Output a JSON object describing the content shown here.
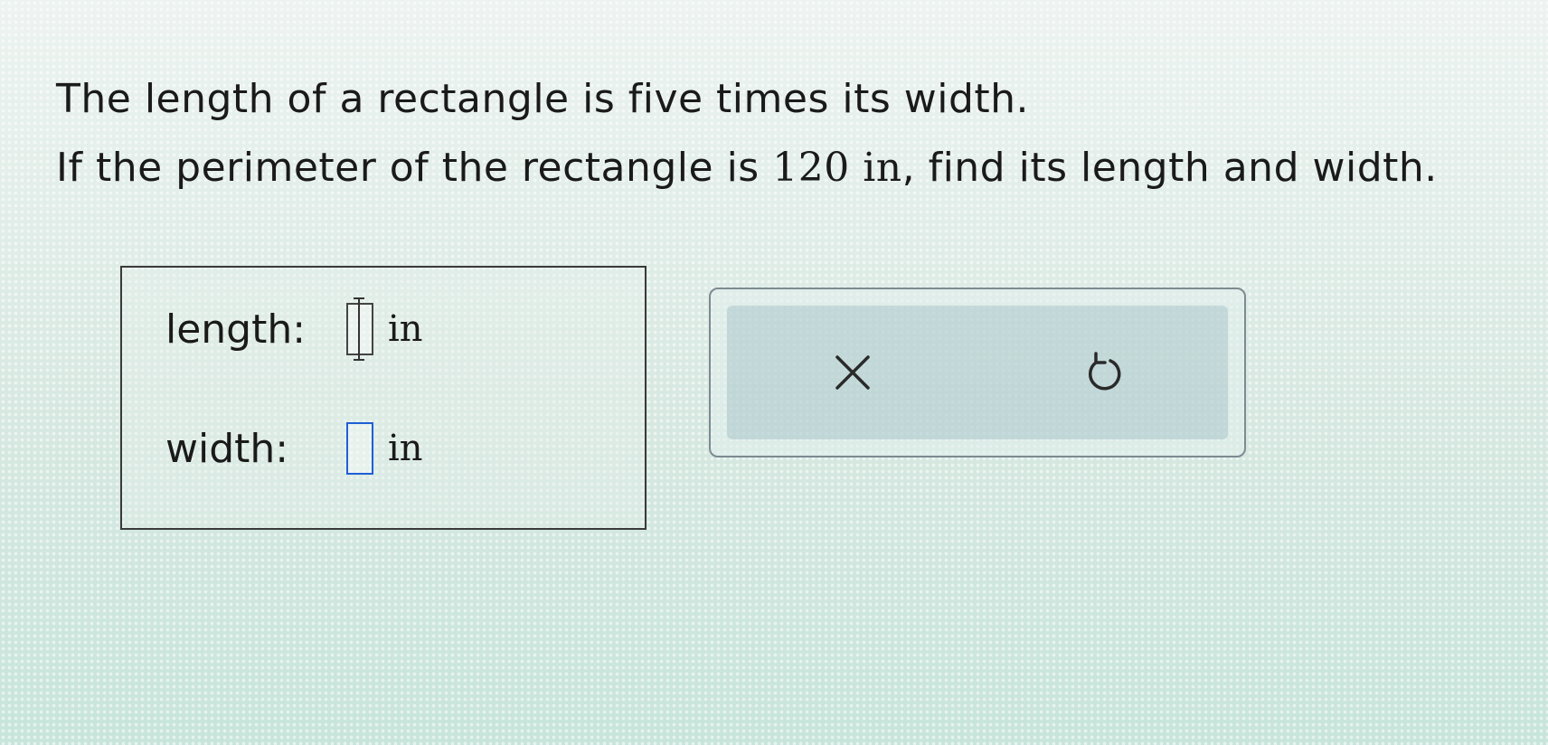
{
  "question": {
    "line1": "The length of a rectangle is five times its width.",
    "line2_before": "If the perimeter of the rectangle is ",
    "line2_value": "120 in",
    "line2_after": ", find its length and width."
  },
  "answer": {
    "length_label": "length:",
    "length_value": "",
    "length_unit": "in",
    "width_label": "width:",
    "width_value": "",
    "width_unit": "in"
  },
  "toolbar": {
    "clear_icon": "x-icon",
    "undo_icon": "undo-icon"
  },
  "colors": {
    "input_border": "#1f5fd6",
    "text": "#1a1a1a"
  }
}
